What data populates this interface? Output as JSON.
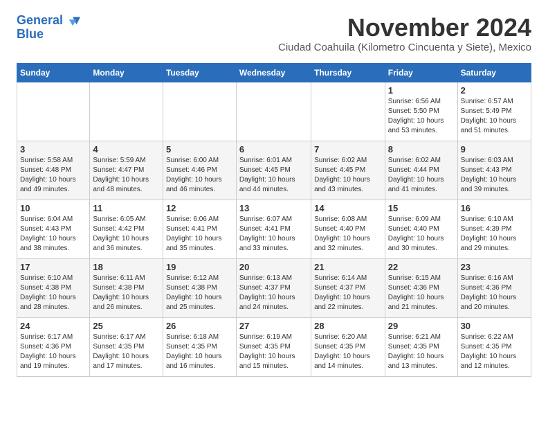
{
  "logo": {
    "line1": "General",
    "line2": "Blue"
  },
  "title": "November 2024",
  "subtitle": "Ciudad Coahuila (Kilometro Cincuenta y Siete), Mexico",
  "headers": [
    "Sunday",
    "Monday",
    "Tuesday",
    "Wednesday",
    "Thursday",
    "Friday",
    "Saturday"
  ],
  "weeks": [
    [
      {
        "day": "",
        "text": ""
      },
      {
        "day": "",
        "text": ""
      },
      {
        "day": "",
        "text": ""
      },
      {
        "day": "",
        "text": ""
      },
      {
        "day": "",
        "text": ""
      },
      {
        "day": "1",
        "text": "Sunrise: 6:56 AM\nSunset: 5:50 PM\nDaylight: 10 hours\nand 53 minutes."
      },
      {
        "day": "2",
        "text": "Sunrise: 6:57 AM\nSunset: 5:49 PM\nDaylight: 10 hours\nand 51 minutes."
      }
    ],
    [
      {
        "day": "3",
        "text": "Sunrise: 5:58 AM\nSunset: 4:48 PM\nDaylight: 10 hours\nand 49 minutes."
      },
      {
        "day": "4",
        "text": "Sunrise: 5:59 AM\nSunset: 4:47 PM\nDaylight: 10 hours\nand 48 minutes."
      },
      {
        "day": "5",
        "text": "Sunrise: 6:00 AM\nSunset: 4:46 PM\nDaylight: 10 hours\nand 46 minutes."
      },
      {
        "day": "6",
        "text": "Sunrise: 6:01 AM\nSunset: 4:45 PM\nDaylight: 10 hours\nand 44 minutes."
      },
      {
        "day": "7",
        "text": "Sunrise: 6:02 AM\nSunset: 4:45 PM\nDaylight: 10 hours\nand 43 minutes."
      },
      {
        "day": "8",
        "text": "Sunrise: 6:02 AM\nSunset: 4:44 PM\nDaylight: 10 hours\nand 41 minutes."
      },
      {
        "day": "9",
        "text": "Sunrise: 6:03 AM\nSunset: 4:43 PM\nDaylight: 10 hours\nand 39 minutes."
      }
    ],
    [
      {
        "day": "10",
        "text": "Sunrise: 6:04 AM\nSunset: 4:43 PM\nDaylight: 10 hours\nand 38 minutes."
      },
      {
        "day": "11",
        "text": "Sunrise: 6:05 AM\nSunset: 4:42 PM\nDaylight: 10 hours\nand 36 minutes."
      },
      {
        "day": "12",
        "text": "Sunrise: 6:06 AM\nSunset: 4:41 PM\nDaylight: 10 hours\nand 35 minutes."
      },
      {
        "day": "13",
        "text": "Sunrise: 6:07 AM\nSunset: 4:41 PM\nDaylight: 10 hours\nand 33 minutes."
      },
      {
        "day": "14",
        "text": "Sunrise: 6:08 AM\nSunset: 4:40 PM\nDaylight: 10 hours\nand 32 minutes."
      },
      {
        "day": "15",
        "text": "Sunrise: 6:09 AM\nSunset: 4:40 PM\nDaylight: 10 hours\nand 30 minutes."
      },
      {
        "day": "16",
        "text": "Sunrise: 6:10 AM\nSunset: 4:39 PM\nDaylight: 10 hours\nand 29 minutes."
      }
    ],
    [
      {
        "day": "17",
        "text": "Sunrise: 6:10 AM\nSunset: 4:38 PM\nDaylight: 10 hours\nand 28 minutes."
      },
      {
        "day": "18",
        "text": "Sunrise: 6:11 AM\nSunset: 4:38 PM\nDaylight: 10 hours\nand 26 minutes."
      },
      {
        "day": "19",
        "text": "Sunrise: 6:12 AM\nSunset: 4:38 PM\nDaylight: 10 hours\nand 25 minutes."
      },
      {
        "day": "20",
        "text": "Sunrise: 6:13 AM\nSunset: 4:37 PM\nDaylight: 10 hours\nand 24 minutes."
      },
      {
        "day": "21",
        "text": "Sunrise: 6:14 AM\nSunset: 4:37 PM\nDaylight: 10 hours\nand 22 minutes."
      },
      {
        "day": "22",
        "text": "Sunrise: 6:15 AM\nSunset: 4:36 PM\nDaylight: 10 hours\nand 21 minutes."
      },
      {
        "day": "23",
        "text": "Sunrise: 6:16 AM\nSunset: 4:36 PM\nDaylight: 10 hours\nand 20 minutes."
      }
    ],
    [
      {
        "day": "24",
        "text": "Sunrise: 6:17 AM\nSunset: 4:36 PM\nDaylight: 10 hours\nand 19 minutes."
      },
      {
        "day": "25",
        "text": "Sunrise: 6:17 AM\nSunset: 4:35 PM\nDaylight: 10 hours\nand 17 minutes."
      },
      {
        "day": "26",
        "text": "Sunrise: 6:18 AM\nSunset: 4:35 PM\nDaylight: 10 hours\nand 16 minutes."
      },
      {
        "day": "27",
        "text": "Sunrise: 6:19 AM\nSunset: 4:35 PM\nDaylight: 10 hours\nand 15 minutes."
      },
      {
        "day": "28",
        "text": "Sunrise: 6:20 AM\nSunset: 4:35 PM\nDaylight: 10 hours\nand 14 minutes."
      },
      {
        "day": "29",
        "text": "Sunrise: 6:21 AM\nSunset: 4:35 PM\nDaylight: 10 hours\nand 13 minutes."
      },
      {
        "day": "30",
        "text": "Sunrise: 6:22 AM\nSunset: 4:35 PM\nDaylight: 10 hours\nand 12 minutes."
      }
    ]
  ]
}
